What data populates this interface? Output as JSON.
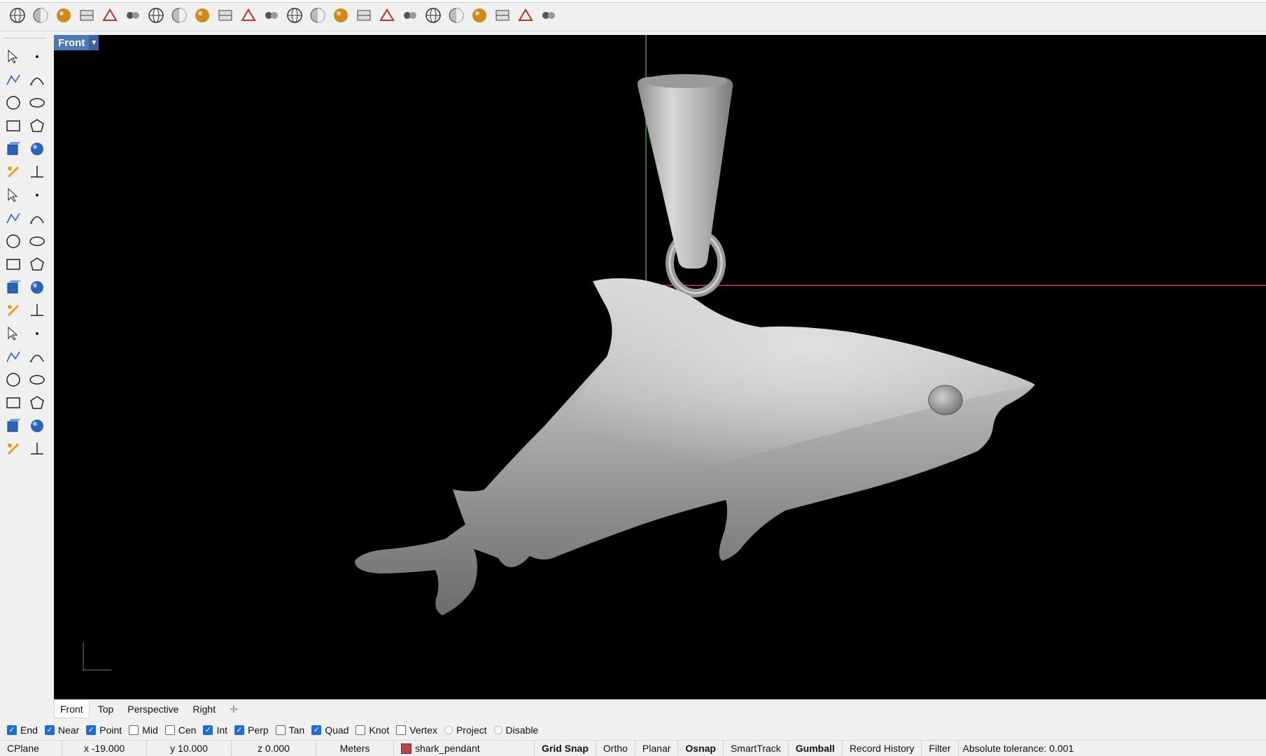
{
  "viewport": {
    "active_title": "Front",
    "object_layer": "shark_pendant"
  },
  "toolbar": {
    "icons": [
      "wireframe-icon",
      "shaded-icon",
      "rendered-icon",
      "blue-sphere-icon",
      "orange-sphere-icon",
      "ghosted-icon",
      "xray-icon",
      "technical-icon",
      "artistic-icon",
      "pen-icon",
      "arctic-icon",
      "raytraced-icon",
      "named-view-icon",
      "camera-icon",
      "halfsphere-icon",
      "light-icon",
      "target-icon",
      "spheres-icon",
      "zoom-icon",
      "delete-icon",
      "display-icon",
      "box-icon",
      "boxes-icon",
      "color-grid-icon"
    ]
  },
  "left_tools": {
    "icons": [
      "select-arrow-icon",
      "point-icon",
      "polyline-icon",
      "curve-cp-icon",
      "circle-icon",
      "ellipse-icon",
      "arc-icon",
      "rectangle-icon",
      "polygon-icon",
      "fillet-curve-icon",
      "surface-icon",
      "lofted-icon",
      "box-solid-icon",
      "boolean-icon",
      "cylinder-icon",
      "plane-icon",
      "explode-icon",
      "extend-icon",
      "trim-icon",
      "split-icon",
      "join-icon",
      "group-icon",
      "offset-icon",
      "blend-icon",
      "text-icon",
      "scale-icon",
      "array-icon",
      "mirror-icon",
      "dimension-icon",
      "measure-icon",
      "array-grid-icon",
      "align-icon",
      "transform-icon",
      "check-icon",
      "mesh-icon",
      "render-icon"
    ]
  },
  "view_tabs": [
    {
      "label": "Front",
      "active": true
    },
    {
      "label": "Top",
      "active": false
    },
    {
      "label": "Perspective",
      "active": false
    },
    {
      "label": "Right",
      "active": false
    }
  ],
  "osnaps": [
    {
      "label": "End",
      "checked": true
    },
    {
      "label": "Near",
      "checked": true
    },
    {
      "label": "Point",
      "checked": true
    },
    {
      "label": "Mid",
      "checked": false
    },
    {
      "label": "Cen",
      "checked": false
    },
    {
      "label": "Int",
      "checked": true
    },
    {
      "label": "Perp",
      "checked": true
    },
    {
      "label": "Tan",
      "checked": false
    },
    {
      "label": "Quad",
      "checked": true
    },
    {
      "label": "Knot",
      "checked": false
    },
    {
      "label": "Vertex",
      "checked": false
    }
  ],
  "osnap_extra": {
    "project": "Project",
    "disable": "Disable"
  },
  "status": {
    "cplane": "CPlane",
    "x": "x -19.000",
    "y": "y 10.000",
    "z": "z 0.000",
    "units": "Meters",
    "layer": "shark_pendant",
    "grid_snap": "Grid Snap",
    "ortho": "Ortho",
    "planar": "Planar",
    "osnap": "Osnap",
    "smarttrack": "SmartTrack",
    "gumball": "Gumball",
    "record_history": "Record History",
    "filter": "Filter",
    "tolerance": "Absolute tolerance: 0.001"
  },
  "colors": {
    "viewport_bg": "#000000",
    "x_axis": "#b84a3f",
    "y_axis": "#3e9a43",
    "tab_active": "#4f79b5",
    "checkbox": "#1f6fd0"
  }
}
